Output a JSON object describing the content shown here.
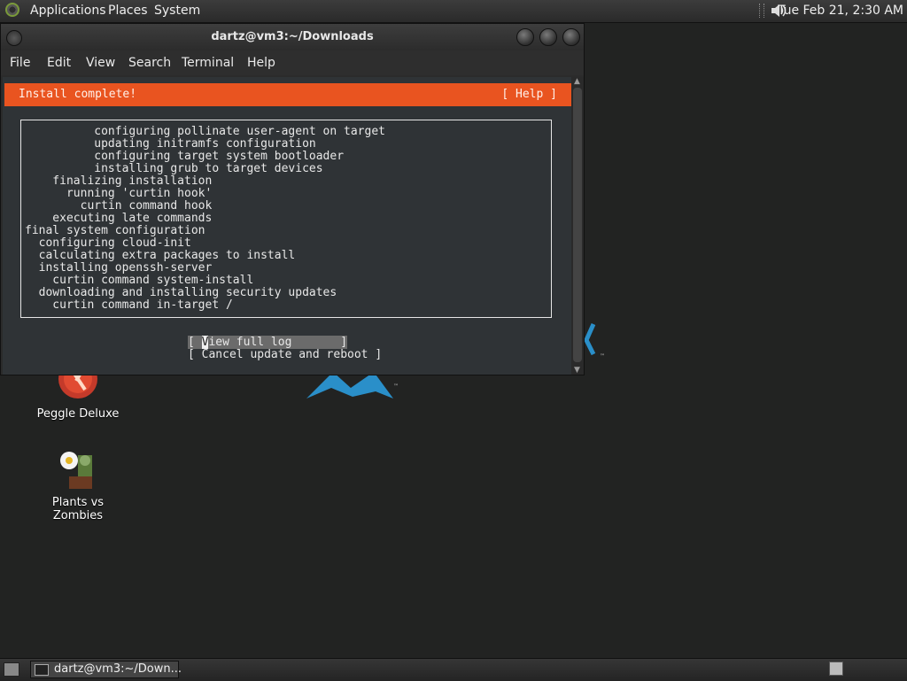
{
  "top_panel": {
    "menus": [
      "Applications",
      "Places",
      "System"
    ],
    "clock": "Tue Feb 21,  2:30 AM",
    "icons": [
      "distro-logo-icon",
      "volume-icon"
    ]
  },
  "desktop": {
    "icons": [
      {
        "label": "Peggle Deluxe",
        "icon": "peggle-icon"
      },
      {
        "label": "Plants vs Zombies",
        "icon": "plants-vs-zombies-icon"
      }
    ],
    "colors": {
      "background": "#222322"
    }
  },
  "window": {
    "title": "dartz@vm3:~/Downloads",
    "menu": [
      "File",
      "Edit",
      "View",
      "Search",
      "Terminal",
      "Help"
    ],
    "controls": [
      "minimize-button",
      "maximize-button",
      "close-button"
    ]
  },
  "installer": {
    "header_title": "Install complete!",
    "help": "[ Help ]",
    "log_lines": [
      "          configuring pollinate user-agent on target",
      "          updating initramfs configuration",
      "          configuring target system bootloader",
      "          installing grub to target devices",
      "    finalizing installation",
      "      running 'curtin hook'",
      "        curtin command hook",
      "    executing late commands",
      "final system configuration",
      "  configuring cloud-init",
      "  calculating extra packages to install",
      "  installing openssh-server",
      "    curtin command system-install",
      "  downloading and installing security updates",
      "    curtin command in-target /"
    ],
    "buttons": [
      {
        "open": "[ ",
        "cursor": "V",
        "rest": "iew full log",
        "close": "       ]",
        "selected": true
      },
      {
        "open": "[ ",
        "cursor": "",
        "rest": "Cancel update and reboot",
        "close": " ]",
        "selected": false
      }
    ],
    "colors": {
      "header": "#e95420",
      "terminal_bg": "#2f3336"
    }
  },
  "bottom_panel": {
    "task_label": "dartz@vm3:~/Down..."
  }
}
